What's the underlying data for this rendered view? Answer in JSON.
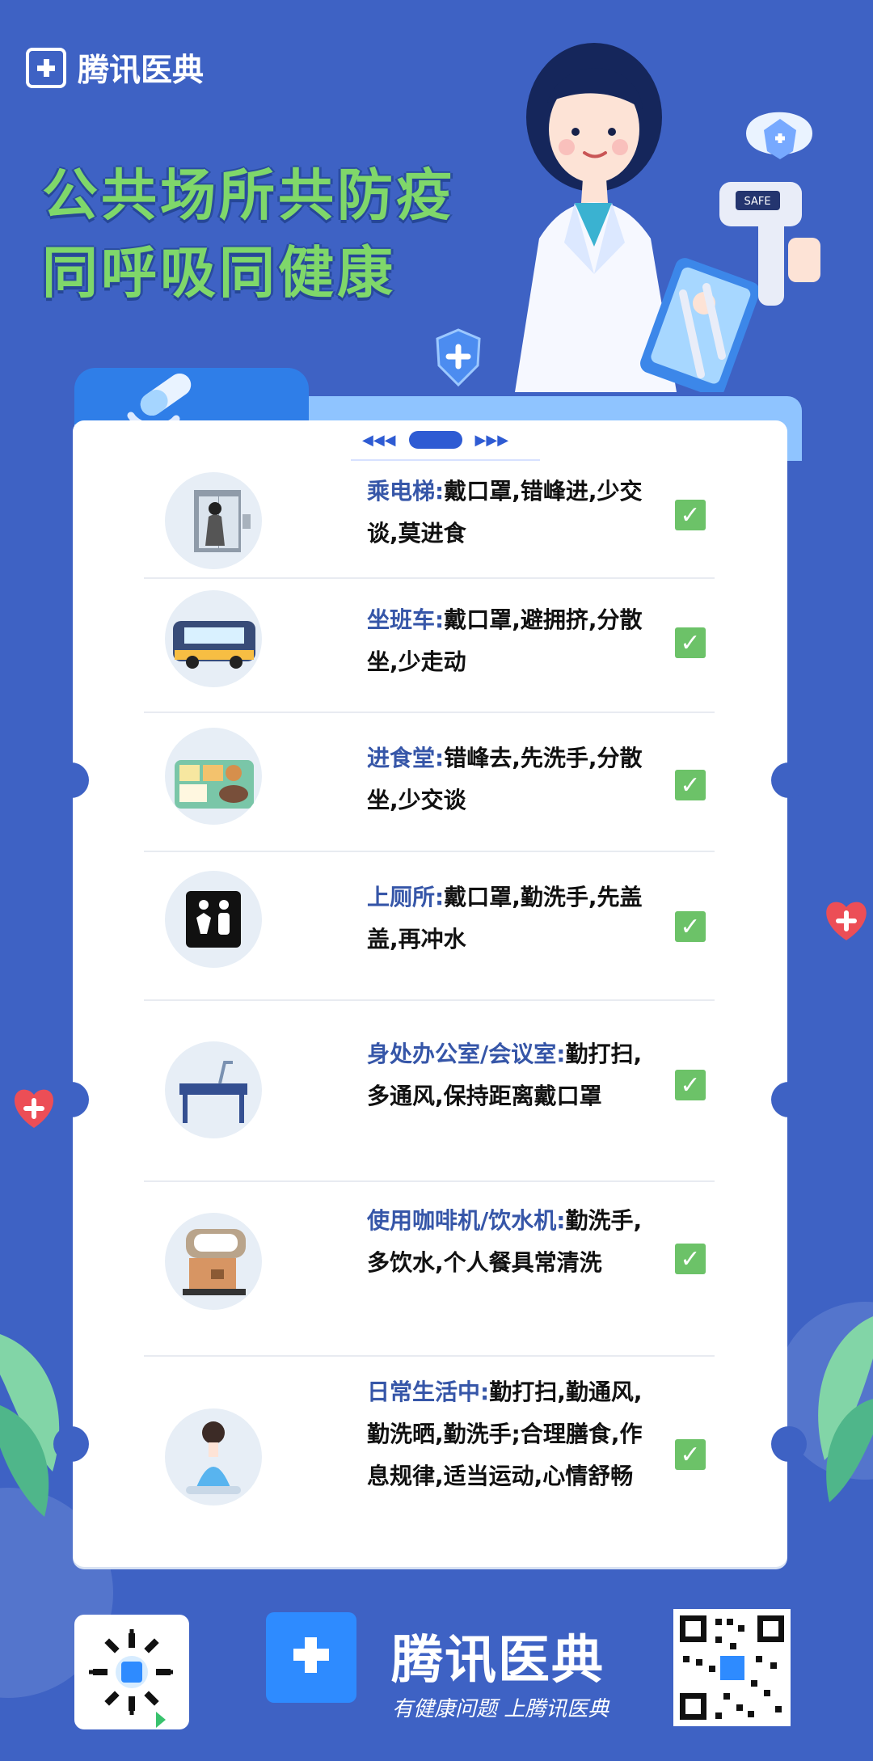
{
  "brand": {
    "name": "腾讯医典",
    "footer_name": "腾讯医典",
    "footer_slogan": "有健康问题 上腾讯医典"
  },
  "headline": {
    "line1": "公共场所共防疫",
    "line2": "同呼吸同健康"
  },
  "illustration": {
    "badge": "SAFE"
  },
  "items": [
    {
      "label": "乘电梯:",
      "text": "戴口罩,错峰进,少交谈,莫进食"
    },
    {
      "label": "坐班车:",
      "text": "戴口罩,避拥挤,分散坐,少走动"
    },
    {
      "label": "进食堂:",
      "text": "错峰去,先洗手,分散坐,少交谈"
    },
    {
      "label": "上厕所:",
      "text": "戴口罩,勤洗手,先盖盖,再冲水"
    },
    {
      "label": "身处办公室/会议室:",
      "text": "勤打扫,多通风,保持距离戴口罩"
    },
    {
      "label": "使用咖啡机/饮水机:",
      "text": "勤洗手,多饮水,个人餐具常清洗"
    },
    {
      "label": "日常生活中:",
      "text": "勤打扫,勤通风,勤洗晒,勤洗手;合理膳食,作息规律,适当运动,心情舒畅"
    }
  ],
  "icons": {
    "elevator": "elevator-icon",
    "bus": "bus-icon",
    "food": "food-tray-icon",
    "toilet": "restroom-icon",
    "office": "desk-icon",
    "coffee": "coffee-machine-icon",
    "daily": "person-washing-icon"
  },
  "colors": {
    "background": "#3e62c4",
    "headline": "#7fd76a",
    "label": "#3656a8",
    "check": "#6cc268"
  }
}
